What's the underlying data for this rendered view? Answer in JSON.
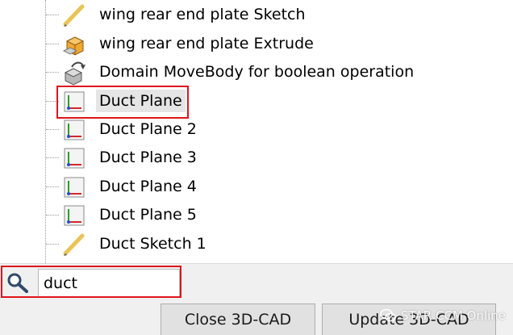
{
  "tree": {
    "items": [
      {
        "label": "wing rear end plate Sketch",
        "icon": "sketch-pencil-icon"
      },
      {
        "label": "wing rear end plate Extrude",
        "icon": "extrude-icon"
      },
      {
        "label": "Domain MoveBody for boolean operation",
        "icon": "move-body-icon"
      },
      {
        "label": "Duct Plane",
        "icon": "plane-axes-icon",
        "selected": true
      },
      {
        "label": "Duct Plane 2",
        "icon": "plane-axes-icon"
      },
      {
        "label": "Duct Plane 3",
        "icon": "plane-axes-icon"
      },
      {
        "label": "Duct Plane 4",
        "icon": "plane-axes-icon"
      },
      {
        "label": "Duct Plane 5",
        "icon": "plane-axes-icon"
      },
      {
        "label": "Duct Sketch 1",
        "icon": "sketch-pencil-icon"
      }
    ]
  },
  "search": {
    "value": "duct",
    "icon": "magnifier-icon"
  },
  "buttons": {
    "close_label": "Close 3D-CAD",
    "update_label": "Update 3D-CAD"
  },
  "watermark": {
    "text": "STAR CCM Online"
  },
  "colors": {
    "highlight_red": "#e0141c",
    "selection_gray": "#e5e5e5",
    "panel_bg": "#f0f0f0"
  }
}
